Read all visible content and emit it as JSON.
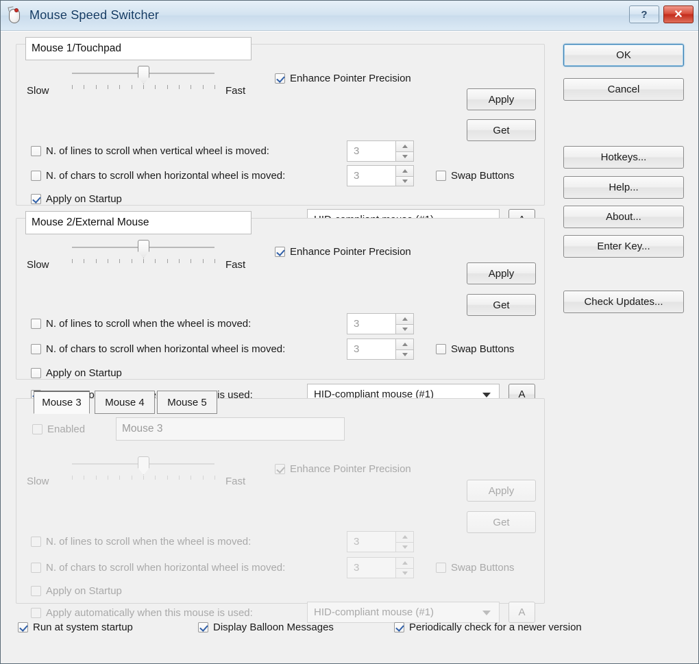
{
  "window": {
    "title": "Mouse Speed Switcher",
    "icon": "mouse-icon",
    "help_button": "?",
    "close_button": "✕"
  },
  "common": {
    "slow_label": "Slow",
    "fast_label": "Fast",
    "enhance_label": "Enhance Pointer Precision",
    "swap_label": "Swap Buttons",
    "apply_startup_label": "Apply on Startup",
    "apply_auto_label": "Apply automatically when this mouse is used:",
    "apply_button": "Apply",
    "get_button": "Get",
    "auto_button": "A",
    "spin_value": "3",
    "device_value": "HID-compliant mouse (#1)"
  },
  "panels": [
    {
      "name_value": "Mouse 1/Touchpad",
      "enhance_checked": true,
      "lines_label": "N. of lines to scroll when vertical wheel is moved:",
      "lines_checked": false,
      "chars_label": "N. of chars to scroll when  horizontal wheel is moved:",
      "chars_checked": false,
      "swap_checked": false,
      "startup_checked": true,
      "auto_checked": true,
      "disabled": false
    },
    {
      "name_value": "Mouse 2/External Mouse",
      "enhance_checked": true,
      "lines_label": "N. of lines to scroll when the wheel is moved:",
      "lines_checked": false,
      "chars_label": "N. of chars to scroll when  horizontal wheel is moved:",
      "chars_checked": false,
      "swap_checked": false,
      "startup_checked": false,
      "auto_checked": true,
      "disabled": false
    },
    {
      "name_value": "Mouse 3",
      "enhance_checked": true,
      "lines_label": "N. of lines to scroll when the wheel is moved:",
      "lines_checked": false,
      "chars_label": "N. of chars to scroll when  horizontal wheel is moved:",
      "chars_checked": false,
      "swap_checked": false,
      "startup_checked": false,
      "auto_checked": false,
      "disabled": true,
      "enabled_label": "Enabled",
      "enabled_checked": false
    }
  ],
  "tabs": [
    {
      "label": "Mouse 3",
      "selected": true
    },
    {
      "label": "Mouse 4",
      "selected": false
    },
    {
      "label": "Mouse 5",
      "selected": false
    }
  ],
  "side_buttons": {
    "ok": "OK",
    "cancel": "Cancel",
    "hotkeys": "Hotkeys...",
    "help": "Help...",
    "about": "About...",
    "enter_key": "Enter Key...",
    "check_updates": "Check Updates..."
  },
  "footer": [
    {
      "label": "Run at system startup",
      "checked": true
    },
    {
      "label": "Display Balloon Messages",
      "checked": true
    },
    {
      "label": "Periodically check for a newer version",
      "checked": true
    }
  ]
}
